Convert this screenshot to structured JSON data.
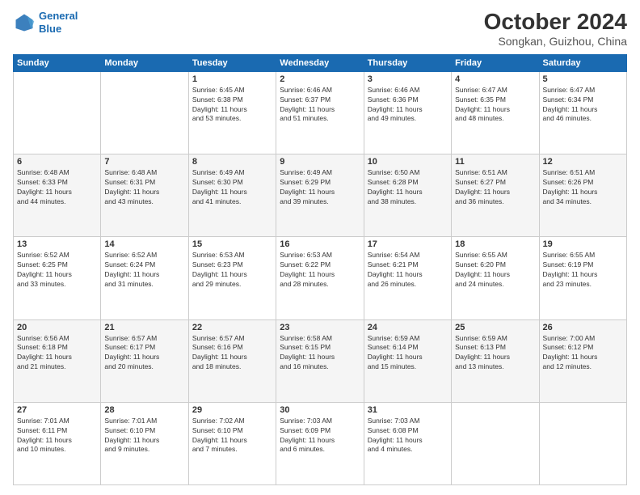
{
  "logo": {
    "line1": "General",
    "line2": "Blue"
  },
  "title": "October 2024",
  "subtitle": "Songkan, Guizhou, China",
  "days_header": [
    "Sunday",
    "Monday",
    "Tuesday",
    "Wednesday",
    "Thursday",
    "Friday",
    "Saturday"
  ],
  "weeks": [
    [
      {
        "day": "",
        "info": ""
      },
      {
        "day": "",
        "info": ""
      },
      {
        "day": "1",
        "info": "Sunrise: 6:45 AM\nSunset: 6:38 PM\nDaylight: 11 hours\nand 53 minutes."
      },
      {
        "day": "2",
        "info": "Sunrise: 6:46 AM\nSunset: 6:37 PM\nDaylight: 11 hours\nand 51 minutes."
      },
      {
        "day": "3",
        "info": "Sunrise: 6:46 AM\nSunset: 6:36 PM\nDaylight: 11 hours\nand 49 minutes."
      },
      {
        "day": "4",
        "info": "Sunrise: 6:47 AM\nSunset: 6:35 PM\nDaylight: 11 hours\nand 48 minutes."
      },
      {
        "day": "5",
        "info": "Sunrise: 6:47 AM\nSunset: 6:34 PM\nDaylight: 11 hours\nand 46 minutes."
      }
    ],
    [
      {
        "day": "6",
        "info": "Sunrise: 6:48 AM\nSunset: 6:33 PM\nDaylight: 11 hours\nand 44 minutes."
      },
      {
        "day": "7",
        "info": "Sunrise: 6:48 AM\nSunset: 6:31 PM\nDaylight: 11 hours\nand 43 minutes."
      },
      {
        "day": "8",
        "info": "Sunrise: 6:49 AM\nSunset: 6:30 PM\nDaylight: 11 hours\nand 41 minutes."
      },
      {
        "day": "9",
        "info": "Sunrise: 6:49 AM\nSunset: 6:29 PM\nDaylight: 11 hours\nand 39 minutes."
      },
      {
        "day": "10",
        "info": "Sunrise: 6:50 AM\nSunset: 6:28 PM\nDaylight: 11 hours\nand 38 minutes."
      },
      {
        "day": "11",
        "info": "Sunrise: 6:51 AM\nSunset: 6:27 PM\nDaylight: 11 hours\nand 36 minutes."
      },
      {
        "day": "12",
        "info": "Sunrise: 6:51 AM\nSunset: 6:26 PM\nDaylight: 11 hours\nand 34 minutes."
      }
    ],
    [
      {
        "day": "13",
        "info": "Sunrise: 6:52 AM\nSunset: 6:25 PM\nDaylight: 11 hours\nand 33 minutes."
      },
      {
        "day": "14",
        "info": "Sunrise: 6:52 AM\nSunset: 6:24 PM\nDaylight: 11 hours\nand 31 minutes."
      },
      {
        "day": "15",
        "info": "Sunrise: 6:53 AM\nSunset: 6:23 PM\nDaylight: 11 hours\nand 29 minutes."
      },
      {
        "day": "16",
        "info": "Sunrise: 6:53 AM\nSunset: 6:22 PM\nDaylight: 11 hours\nand 28 minutes."
      },
      {
        "day": "17",
        "info": "Sunrise: 6:54 AM\nSunset: 6:21 PM\nDaylight: 11 hours\nand 26 minutes."
      },
      {
        "day": "18",
        "info": "Sunrise: 6:55 AM\nSunset: 6:20 PM\nDaylight: 11 hours\nand 24 minutes."
      },
      {
        "day": "19",
        "info": "Sunrise: 6:55 AM\nSunset: 6:19 PM\nDaylight: 11 hours\nand 23 minutes."
      }
    ],
    [
      {
        "day": "20",
        "info": "Sunrise: 6:56 AM\nSunset: 6:18 PM\nDaylight: 11 hours\nand 21 minutes."
      },
      {
        "day": "21",
        "info": "Sunrise: 6:57 AM\nSunset: 6:17 PM\nDaylight: 11 hours\nand 20 minutes."
      },
      {
        "day": "22",
        "info": "Sunrise: 6:57 AM\nSunset: 6:16 PM\nDaylight: 11 hours\nand 18 minutes."
      },
      {
        "day": "23",
        "info": "Sunrise: 6:58 AM\nSunset: 6:15 PM\nDaylight: 11 hours\nand 16 minutes."
      },
      {
        "day": "24",
        "info": "Sunrise: 6:59 AM\nSunset: 6:14 PM\nDaylight: 11 hours\nand 15 minutes."
      },
      {
        "day": "25",
        "info": "Sunrise: 6:59 AM\nSunset: 6:13 PM\nDaylight: 11 hours\nand 13 minutes."
      },
      {
        "day": "26",
        "info": "Sunrise: 7:00 AM\nSunset: 6:12 PM\nDaylight: 11 hours\nand 12 minutes."
      }
    ],
    [
      {
        "day": "27",
        "info": "Sunrise: 7:01 AM\nSunset: 6:11 PM\nDaylight: 11 hours\nand 10 minutes."
      },
      {
        "day": "28",
        "info": "Sunrise: 7:01 AM\nSunset: 6:10 PM\nDaylight: 11 hours\nand 9 minutes."
      },
      {
        "day": "29",
        "info": "Sunrise: 7:02 AM\nSunset: 6:10 PM\nDaylight: 11 hours\nand 7 minutes."
      },
      {
        "day": "30",
        "info": "Sunrise: 7:03 AM\nSunset: 6:09 PM\nDaylight: 11 hours\nand 6 minutes."
      },
      {
        "day": "31",
        "info": "Sunrise: 7:03 AM\nSunset: 6:08 PM\nDaylight: 11 hours\nand 4 minutes."
      },
      {
        "day": "",
        "info": ""
      },
      {
        "day": "",
        "info": ""
      }
    ]
  ]
}
